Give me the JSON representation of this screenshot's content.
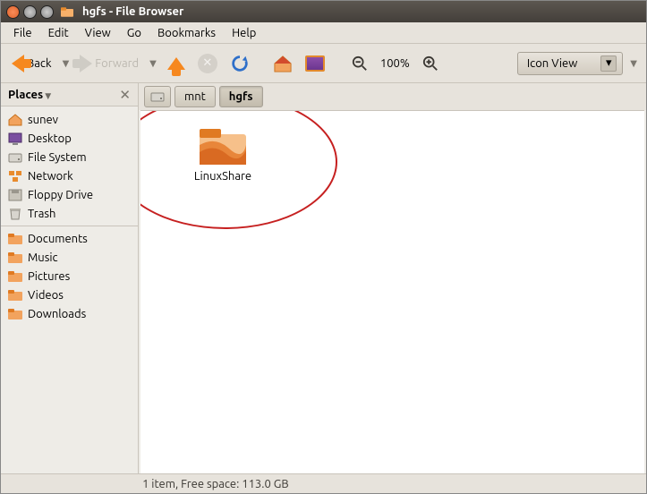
{
  "window": {
    "title": "hgfs - File Browser"
  },
  "menu": [
    "File",
    "Edit",
    "View",
    "Go",
    "Bookmarks",
    "Help"
  ],
  "toolbar": {
    "back": "Back",
    "forward": "Forward",
    "zoom_level": "100%",
    "view_mode": "Icon View"
  },
  "sidebar": {
    "header": "Places",
    "groups": [
      [
        {
          "icon": "home",
          "label": "sunev"
        },
        {
          "icon": "desktop",
          "label": "Desktop"
        },
        {
          "icon": "disk",
          "label": "File System"
        },
        {
          "icon": "network",
          "label": "Network"
        },
        {
          "icon": "floppy",
          "label": "Floppy Drive"
        },
        {
          "icon": "trash",
          "label": "Trash"
        }
      ],
      [
        {
          "icon": "folder",
          "label": "Documents"
        },
        {
          "icon": "folder",
          "label": "Music"
        },
        {
          "icon": "folder",
          "label": "Pictures"
        },
        {
          "icon": "folder",
          "label": "Videos"
        },
        {
          "icon": "folder",
          "label": "Downloads"
        }
      ]
    ]
  },
  "pathbar": {
    "segments": [
      {
        "label": "",
        "icon": "disk"
      },
      {
        "label": "mnt"
      },
      {
        "label": "hgfs",
        "active": true
      }
    ]
  },
  "files": [
    {
      "name": "LinuxShare",
      "type": "folder"
    }
  ],
  "status": "1 item, Free space: 113.0 GB",
  "annotation": {
    "ellipse": true
  }
}
